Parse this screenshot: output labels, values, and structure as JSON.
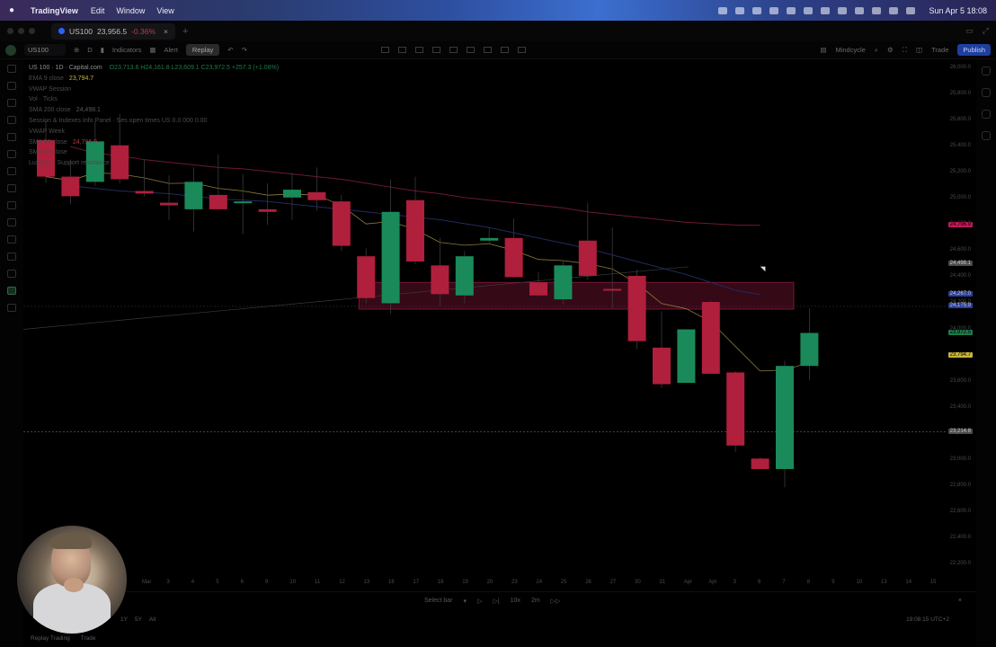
{
  "menubar": {
    "app_name": "TradingView",
    "menus": [
      "Edit",
      "Window",
      "View"
    ],
    "clock": "Sun Apr 5  18:08"
  },
  "tab": {
    "symbol": "US100",
    "price": "23,956.5",
    "change": "-0.36%"
  },
  "toolbar": {
    "symbol": "US100",
    "interval": "D",
    "indicators": "Indicators",
    "alert": "Alert",
    "replay": "Replay",
    "layout_name": "Mindcycle",
    "trade": "Trade",
    "publish": "Publish"
  },
  "legend": {
    "title": "US 100 · 1D · Capital.com",
    "ohlc": "O23,713.6 H24,161.8 L23,609.1 C23,972.5 +257.3 (+1.08%)",
    "rows": [
      {
        "name": "EMA 9 close",
        "value": "23,794.7",
        "cls": "ema"
      },
      {
        "name": "VWAP Session",
        "value": "",
        "cls": ""
      },
      {
        "name": "Vol · Ticks",
        "value": "",
        "cls": ""
      },
      {
        "name": "SMA 200 close",
        "value": "24,498.1",
        "cls": "sma200"
      },
      {
        "name": "Session & Indexes Info Panel · Ses open times US 0.0 000 0.00",
        "value": "",
        "cls": ""
      },
      {
        "name": "VWAP Week",
        "value": "",
        "cls": ""
      },
      {
        "name": "SMA 50 close",
        "value": "24,796.9",
        "cls": "sma50"
      },
      {
        "name": "SMA 20 close",
        "value": "",
        "cls": ""
      },
      {
        "name": "LuxAlgo · Support resistance",
        "value": "",
        "cls": ""
      }
    ]
  },
  "price_axis": {
    "labels": [
      "26,000.0",
      "25,800.0",
      "25,600.0",
      "25,400.0",
      "25,200.0",
      "25,000.0",
      "24,800.0",
      "24,600.0",
      "24,400.0",
      "24,200.0",
      "24,000.0",
      "23,800.0",
      "23,600.0",
      "23,400.0",
      "23,200.0",
      "23,000.0",
      "22,800.0",
      "22,600.0",
      "22,400.0",
      "22,200.0"
    ],
    "tags": [
      {
        "text": "24,796.9",
        "color": "#c2185b"
      },
      {
        "text": "24,498.1",
        "color": "#4a4a4a"
      },
      {
        "text": "24,267.0",
        "color": "#2a3f9e"
      },
      {
        "text": "24,175.9",
        "color": "#2a3f9e"
      },
      {
        "text": "23,972.5",
        "color": "#1e7a4c"
      },
      {
        "text": "23,794.7",
        "color": "#c9b53a"
      },
      {
        "text": "23,214.8",
        "color": "#4a4a4a"
      }
    ]
  },
  "time_axis": {
    "labels": [
      "Mar",
      "3",
      "4",
      "5",
      "6",
      "9",
      "10",
      "11",
      "12",
      "13",
      "16",
      "17",
      "18",
      "19",
      "20",
      "23",
      "24",
      "25",
      "26",
      "27",
      "30",
      "31",
      "Apr",
      "Apr",
      "3",
      "6",
      "7",
      "8",
      "9",
      "10",
      "13",
      "14",
      "15"
    ]
  },
  "replay_bar": {
    "select_bar": "Select bar",
    "speed": "10x",
    "interval": "2m"
  },
  "bottom_bar": {
    "ranges": [
      "1Y",
      "5Y",
      "All"
    ],
    "time": "19:08:15 UTC+2"
  },
  "bottom_panel": {
    "tabs": [
      "Replay Trading",
      "Trade"
    ]
  },
  "chart_data": {
    "type": "candlestick",
    "ohlc": [
      {
        "o": 25450,
        "h": 25600,
        "l": 25120,
        "c": 25170
      },
      {
        "o": 25170,
        "h": 25300,
        "l": 24960,
        "c": 25020
      },
      {
        "o": 25130,
        "h": 25590,
        "l": 25100,
        "c": 25440
      },
      {
        "o": 25410,
        "h": 25650,
        "l": 25120,
        "c": 25150
      },
      {
        "o": 25060,
        "h": 25300,
        "l": 25020,
        "c": 25040
      },
      {
        "o": 24970,
        "h": 25180,
        "l": 24840,
        "c": 24950
      },
      {
        "o": 24920,
        "h": 25240,
        "l": 24750,
        "c": 25130
      },
      {
        "o": 25030,
        "h": 25340,
        "l": 24990,
        "c": 24920
      },
      {
        "o": 24980,
        "h": 25190,
        "l": 24730,
        "c": 24980
      },
      {
        "o": 24920,
        "h": 25120,
        "l": 24800,
        "c": 24900
      },
      {
        "o": 25010,
        "h": 25200,
        "l": 24840,
        "c": 25070
      },
      {
        "o": 25050,
        "h": 25240,
        "l": 24910,
        "c": 24990
      },
      {
        "o": 24980,
        "h": 25030,
        "l": 24600,
        "c": 24640
      },
      {
        "o": 24560,
        "h": 24620,
        "l": 24200,
        "c": 24240
      },
      {
        "o": 24200,
        "h": 25150,
        "l": 24120,
        "c": 24900
      },
      {
        "o": 24990,
        "h": 25170,
        "l": 24500,
        "c": 24520
      },
      {
        "o": 24490,
        "h": 24700,
        "l": 24180,
        "c": 24270
      },
      {
        "o": 24260,
        "h": 24600,
        "l": 24200,
        "c": 24560
      },
      {
        "o": 24680,
        "h": 24780,
        "l": 24650,
        "c": 24700
      },
      {
        "o": 24700,
        "h": 24850,
        "l": 24420,
        "c": 24400
      },
      {
        "o": 24360,
        "h": 24440,
        "l": 24250,
        "c": 24260
      },
      {
        "o": 24230,
        "h": 24530,
        "l": 24190,
        "c": 24490
      },
      {
        "o": 24680,
        "h": 24970,
        "l": 24380,
        "c": 24410
      },
      {
        "o": 24310,
        "h": 24780,
        "l": 24160,
        "c": 24300
      },
      {
        "o": 24410,
        "h": 24460,
        "l": 23850,
        "c": 23910
      },
      {
        "o": 23860,
        "h": 24140,
        "l": 23550,
        "c": 23580
      },
      {
        "o": 23590,
        "h": 23820,
        "l": 23600,
        "c": 24000
      },
      {
        "o": 24210,
        "h": 24220,
        "l": 23670,
        "c": 23660
      },
      {
        "o": 23670,
        "h": 23680,
        "l": 23060,
        "c": 23110
      },
      {
        "o": 23010,
        "h": 23020,
        "l": 22960,
        "c": 22930
      },
      {
        "o": 22930,
        "h": 23760,
        "l": 22790,
        "c": 23720
      },
      {
        "o": 23720,
        "h": 24161.8,
        "l": 23609.1,
        "c": 23972.5
      }
    ],
    "ylim": [
      22200,
      26000
    ],
    "horizontal_levels": [
      23214.8
    ],
    "zone": {
      "low": 24155,
      "high": 24360
    }
  }
}
